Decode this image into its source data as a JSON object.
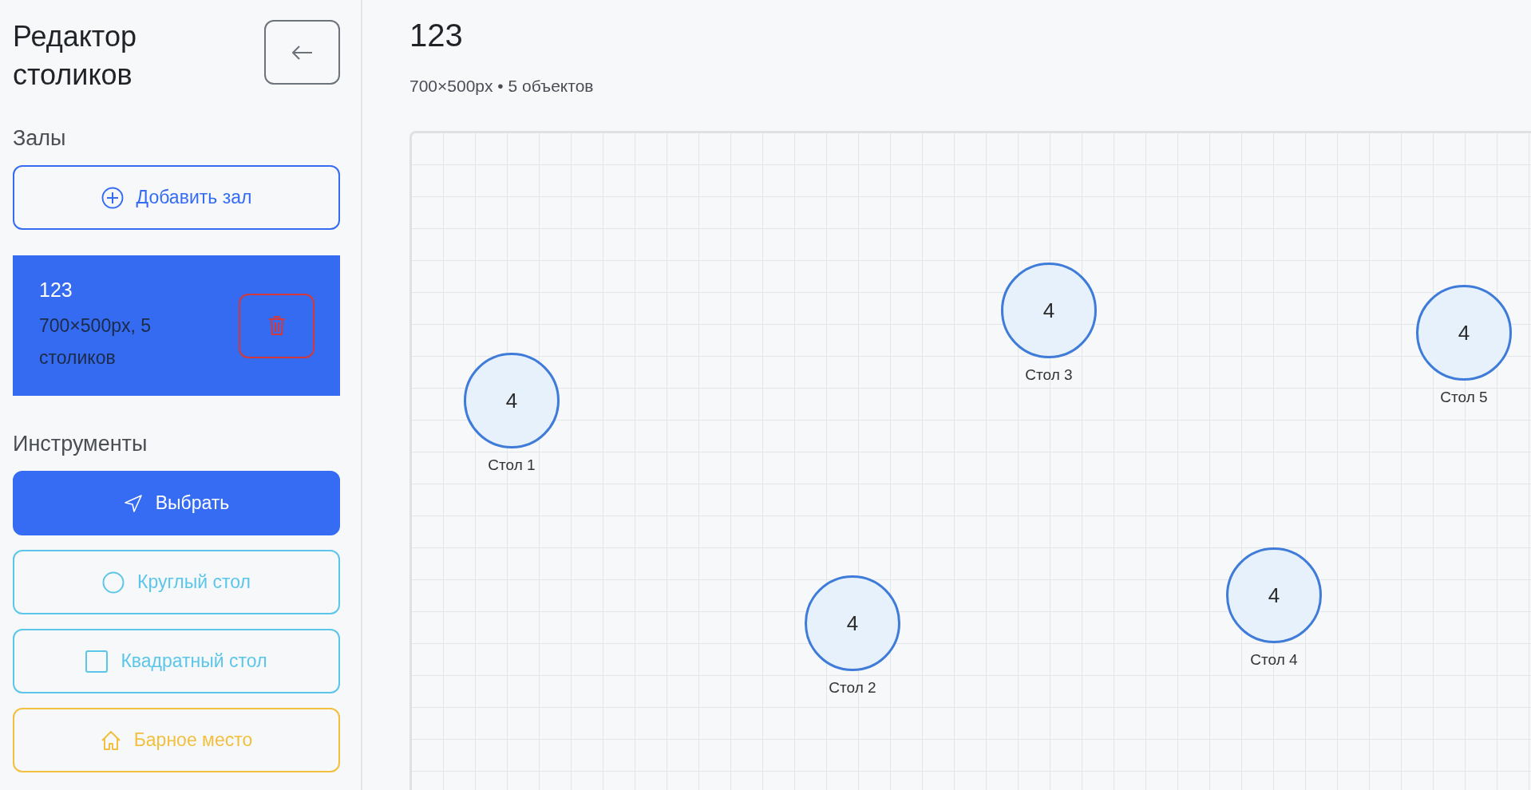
{
  "sidebar": {
    "title": "Редактор столиков",
    "halls_heading": "Залы",
    "add_hall_label": "Добавить зал",
    "halls": [
      {
        "name": "123",
        "info": "700×500px, 5 столиков",
        "selected": true
      }
    ],
    "tools_heading": "Инструменты",
    "tools": [
      {
        "kind": "select",
        "label": "Выбрать",
        "selected": true
      },
      {
        "kind": "round",
        "label": "Круглый стол",
        "selected": false
      },
      {
        "kind": "square",
        "label": "Квадратный стол",
        "selected": false
      },
      {
        "kind": "bar",
        "label": "Барное место",
        "selected": false
      }
    ]
  },
  "hall": {
    "title": "123",
    "subtitle": "700×500px • 5 объектов",
    "tables": [
      {
        "kind": "round",
        "seats": "4",
        "name": "Стол 1"
      },
      {
        "kind": "round",
        "seats": "4",
        "name": "Стол 2"
      },
      {
        "kind": "round",
        "seats": "4",
        "name": "Стол 3"
      },
      {
        "kind": "round",
        "seats": "4",
        "name": "Стол 4"
      },
      {
        "kind": "round",
        "seats": "4",
        "name": "Стол 5"
      }
    ]
  }
}
